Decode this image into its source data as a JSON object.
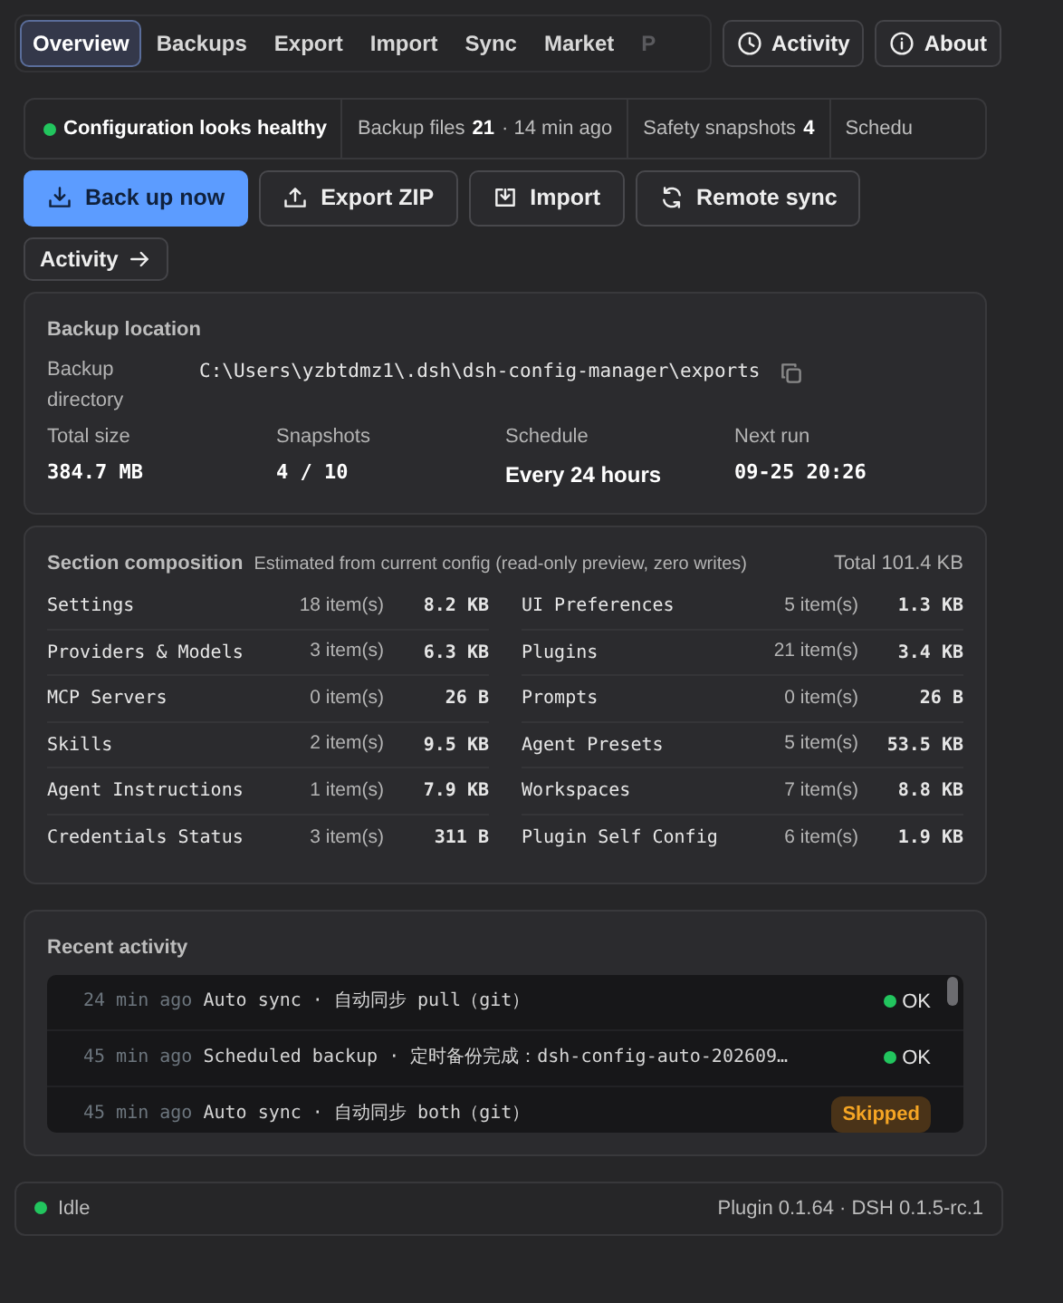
{
  "tabs": [
    {
      "label": "Overview",
      "selected": true
    },
    {
      "label": "Backups",
      "selected": false
    },
    {
      "label": "Export",
      "selected": false
    },
    {
      "label": "Import",
      "selected": false
    },
    {
      "label": "Sync",
      "selected": false
    },
    {
      "label": "Market",
      "selected": false
    },
    {
      "label": "P",
      "selected": false
    }
  ],
  "header_buttons": [
    {
      "kind": "clock",
      "label": "Activity"
    },
    {
      "kind": "info",
      "label": "About"
    }
  ],
  "status_strip": [
    {
      "kind": "health",
      "label": "Configuration looks healthy",
      "color": "#22c55e"
    },
    {
      "kind": "stat",
      "label": "Backup files",
      "value": "21",
      "note": "· 14 min ago"
    },
    {
      "kind": "stat",
      "label": "Safety snapshots",
      "value": "4"
    },
    {
      "kind": "stat",
      "label": "Schedu"
    }
  ],
  "actions": [
    {
      "kind": "download",
      "label": "Back up now",
      "primary": true
    },
    {
      "kind": "upload",
      "label": "Export ZIP",
      "primary": false
    },
    {
      "kind": "import",
      "label": "Import",
      "primary": false
    },
    {
      "kind": "sync",
      "label": "Remote sync",
      "primary": false
    }
  ],
  "activity_link": "Activity",
  "backup_location": {
    "title": "Backup location",
    "dir_label": "Backup directory",
    "dir_path": "C:\\Users\\yzbtdmz1\\.dsh\\dsh-config-manager\\exports",
    "stats": [
      {
        "label": "Total size",
        "value": "384.7 MB",
        "mono": true
      },
      {
        "label": "Snapshots",
        "value": "4 / 10",
        "mono": true
      },
      {
        "label": "Schedule",
        "value": "Every 24 hours",
        "mono": false
      },
      {
        "label": "Next run",
        "value": "09-25 20:26",
        "mono": true
      }
    ]
  },
  "composition": {
    "title": "Section composition",
    "subtitle": "Estimated from current config (read-only preview, zero writes)",
    "total": "Total 101.4 KB",
    "items": [
      {
        "name": "Settings",
        "count": "18 item(s)",
        "size": "8.2 KB"
      },
      {
        "name": "UI Preferences",
        "count": "5 item(s)",
        "size": "1.3 KB"
      },
      {
        "name": "Providers & Models",
        "count": "3 item(s)",
        "size": "6.3 KB"
      },
      {
        "name": "Plugins",
        "count": "21 item(s)",
        "size": "3.4 KB"
      },
      {
        "name": "MCP Servers",
        "count": "0 item(s)",
        "size": "26 B"
      },
      {
        "name": "Prompts",
        "count": "0 item(s)",
        "size": "26 B"
      },
      {
        "name": "Skills",
        "count": "2 item(s)",
        "size": "9.5 KB"
      },
      {
        "name": "Agent Presets",
        "count": "5 item(s)",
        "size": "53.5 KB"
      },
      {
        "name": "Agent Instructions",
        "count": "1 item(s)",
        "size": "7.9 KB"
      },
      {
        "name": "Workspaces",
        "count": "7 item(s)",
        "size": "8.8 KB"
      },
      {
        "name": "Credentials Status",
        "count": "3 item(s)",
        "size": "311 B"
      },
      {
        "name": "Plugin Self Config",
        "count": "6 item(s)",
        "size": "1.9 KB"
      }
    ]
  },
  "recent_activity": {
    "title": "Recent activity",
    "rows": [
      {
        "time": "24 min ago",
        "text": "Auto sync · 自动同步 pull（git）",
        "kind": "ok",
        "status": "OK",
        "color": "#22c55e"
      },
      {
        "time": "45 min ago",
        "text": "Scheduled backup · 定时备份完成：dsh-config-auto-202609…",
        "kind": "ok",
        "status": "OK",
        "color": "#22c55e"
      },
      {
        "time": "45 min ago",
        "text": "Auto sync · 自动同步 both（git）",
        "kind": "skipped",
        "status": "Skipped"
      }
    ]
  },
  "footer": {
    "state": "Idle",
    "color": "#22c55e",
    "version": "Plugin 0.1.64 · DSH 0.1.5-rc.1"
  }
}
